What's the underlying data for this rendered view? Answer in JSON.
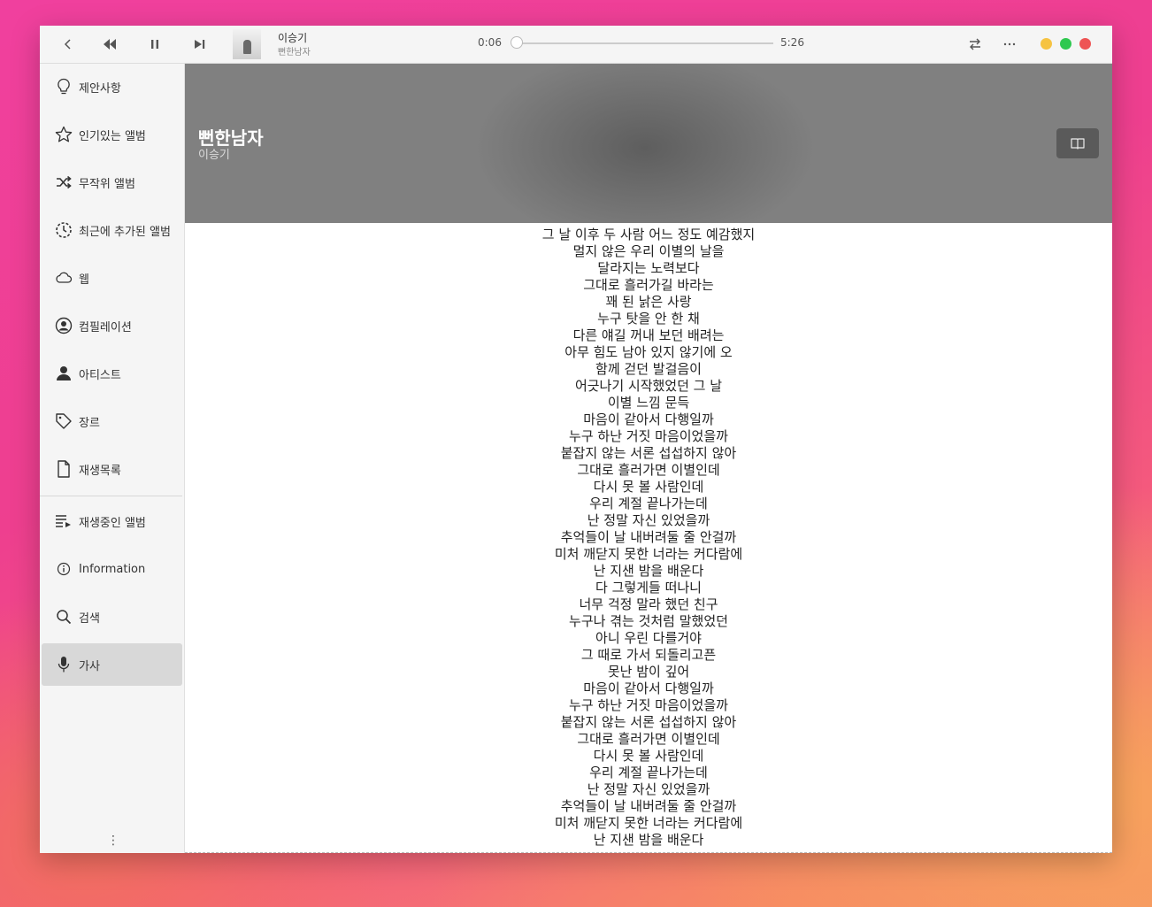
{
  "player": {
    "track_title": "이승기",
    "track_album": "뻔한남자",
    "time_current": "0:06",
    "time_total": "5:26",
    "progress_fraction": 0.019
  },
  "window_controls": {
    "minimize_color": "#f6c342",
    "maximize_color": "#2fc84f",
    "close_color": "#ee5454"
  },
  "sidebar": {
    "items": [
      {
        "label": "제안사항",
        "icon": "lightbulb-icon"
      },
      {
        "label": "인기있는 앨범",
        "icon": "star-icon"
      },
      {
        "label": "무작위 앨범",
        "icon": "shuffle-icon"
      },
      {
        "label": "최근에 추가된 앨범",
        "icon": "recent-icon"
      },
      {
        "label": "웹",
        "icon": "cloud-icon"
      },
      {
        "label": "컴필레이션",
        "icon": "user-circle-icon"
      },
      {
        "label": "아티스트",
        "icon": "person-icon"
      },
      {
        "label": "장르",
        "icon": "tag-icon"
      },
      {
        "label": "재생목록",
        "icon": "document-icon"
      },
      {
        "label": "재생중인 앨범",
        "icon": "queue-icon"
      },
      {
        "label": "Information",
        "icon": "info-icon"
      },
      {
        "label": "검색",
        "icon": "search-icon"
      },
      {
        "label": "가사",
        "icon": "microphone-icon"
      }
    ],
    "active_index": 12
  },
  "header": {
    "title": "뻔한남자",
    "artist": "이승기"
  },
  "lyrics": [
    "그 날 이후 두 사람 어느 정도 예감했지",
    "멀지 않은 우리 이별의 날을",
    "달라지는 노력보다",
    "그대로 흘러가길 바라는",
    "꽤 된 낡은 사랑",
    "누구 탓을 안 한 채",
    "다른 얘길 꺼내 보던 배려는",
    "아무 힘도 남아 있지 않기에 오",
    "함께 걷던 발걸음이",
    "어긋나기 시작했었던 그 날",
    "이별 느낌 문득",
    "마음이 같아서 다행일까",
    "누구 하난 거짓 마음이었을까",
    "붙잡지 않는 서론 섭섭하지 않아",
    "그대로 흘러가면 이별인데",
    "다시 못 볼 사람인데",
    "우리 계절 끝나가는데",
    "난 정말 자신 있었을까",
    "추억들이 날 내버려둘 줄 안걸까",
    "미처 깨닫지 못한 너라는 커다람에",
    "난 지샌 밤을 배운다",
    "다 그렇게들 떠나니",
    "너무 걱정 말라 했던 친구",
    "누구나 겪는 것처럼 말했었던",
    "아니 우린 다를거야",
    "그 때로 가서 되돌리고픈",
    "못난 밤이 깊어",
    "마음이 같아서 다행일까",
    "누구 하난 거짓 마음이었을까",
    "붙잡지 않는 서론 섭섭하지 않아",
    "그대로 흘러가면 이별인데",
    "다시 못 볼 사람인데",
    "우리 계절 끝나가는데",
    "난 정말 자신 있었을까",
    "추억들이 날 내버려둘 줄 안걸까",
    "미처 깨닫지 못한 너라는 커다람에",
    "난 지샌 밤을 배운다"
  ]
}
